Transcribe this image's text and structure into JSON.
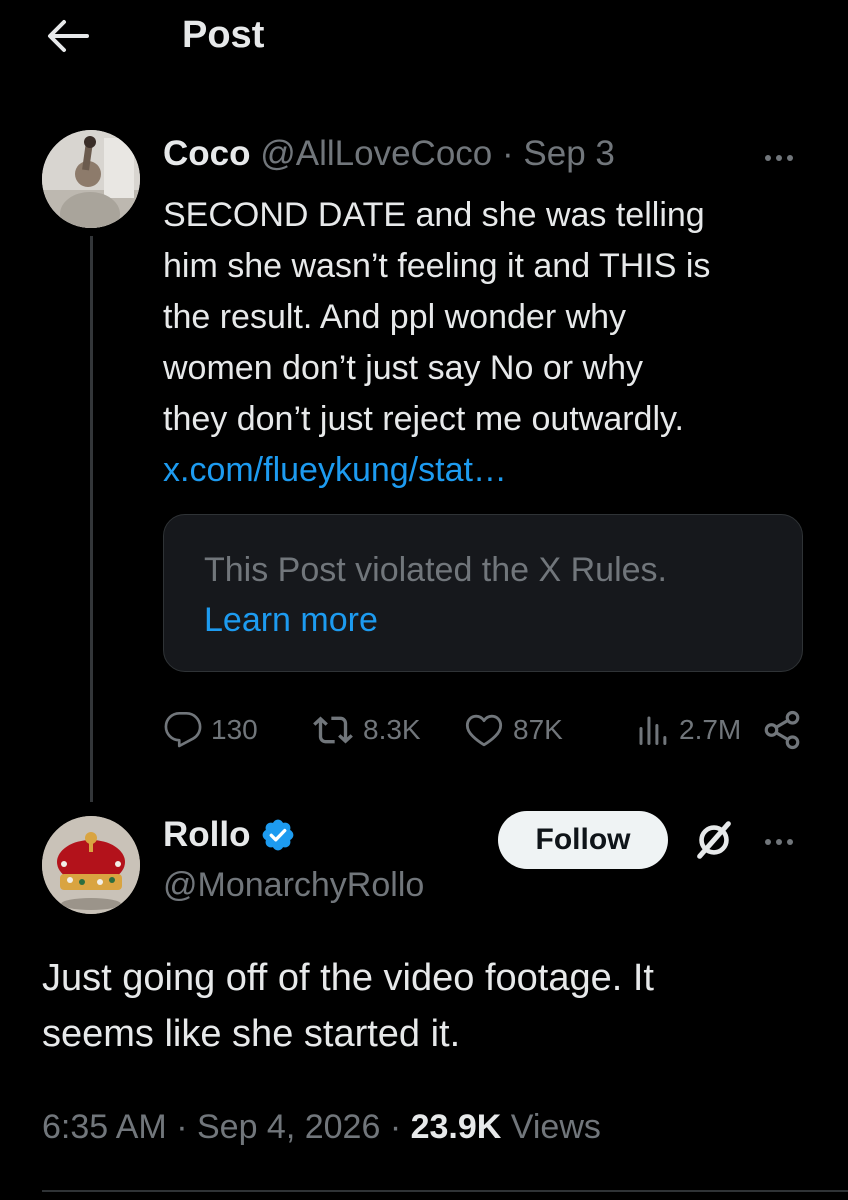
{
  "header": {
    "title": "Post",
    "back_icon": "arrow-left-icon"
  },
  "quoted_post": {
    "author_name": "Coco",
    "author_handle": "@AllLoveCoco",
    "separator": "·",
    "date": "Sep 3",
    "text_lines": [
      "SECOND DATE and she was telling",
      "him she wasn’t feeling it and THIS is",
      "the result. And ppl wonder why",
      "women don’t just say No or why",
      "they don’t just reject me outwardly."
    ],
    "link": "x.com/flueykung/stat…",
    "violation_notice": {
      "text": "This Post violated the X Rules.",
      "link": "Learn more"
    },
    "actions": {
      "replies": "130",
      "reposts": "8.3K",
      "likes": "87K",
      "views": "2.7M"
    }
  },
  "reply": {
    "author_name": "Rollo",
    "author_handle": "@MonarchyRollo",
    "verified": true,
    "follow_label": "Follow",
    "text_lines": [
      "Just going off of the video footage. It",
      "seems like she started it."
    ],
    "time": "6:35 AM",
    "separator": "·",
    "date": "Sep 4, 2026",
    "views_count": "23.9K",
    "views_label": "Views"
  },
  "colors": {
    "background": "#000000",
    "text": "#e7e9ea",
    "muted": "#71767b",
    "link": "#1d9bf0",
    "verified": "#1d9bf0"
  }
}
